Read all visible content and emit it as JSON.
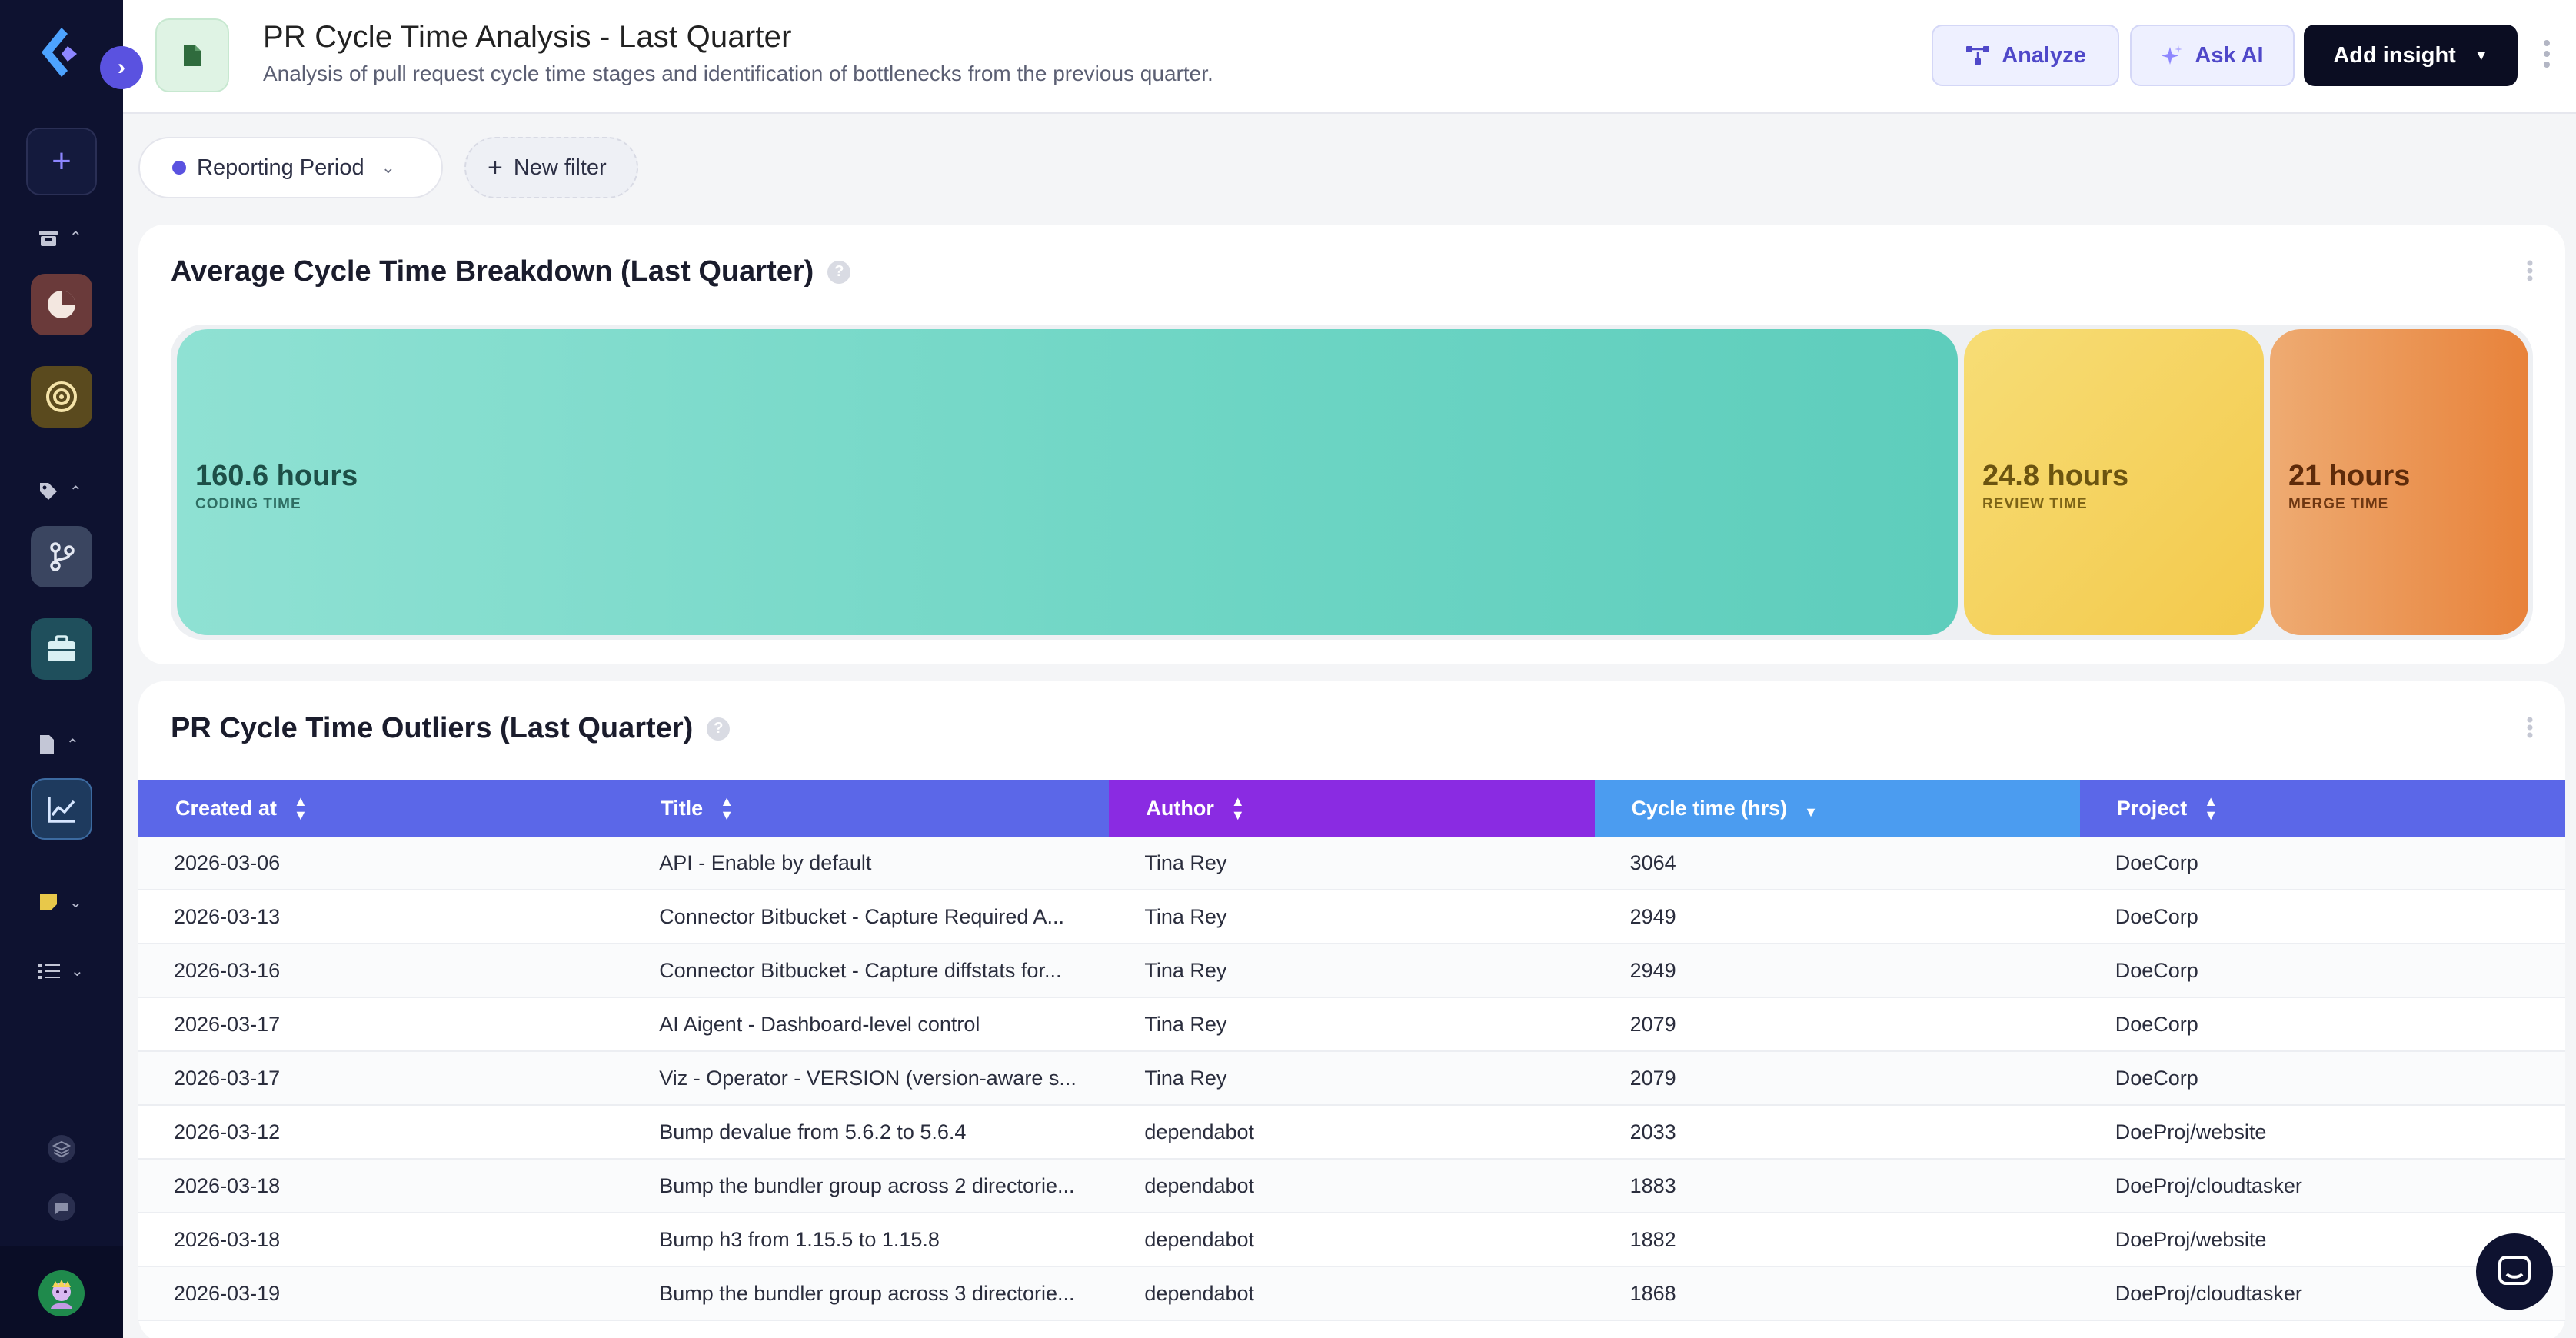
{
  "header": {
    "title": "PR Cycle Time Analysis - Last Quarter",
    "subtitle": "Analysis of pull request cycle time stages and identification of bottlenecks from the previous quarter.",
    "analyze_label": "Analyze",
    "ask_ai_label": "Ask AI",
    "add_insight_label": "Add insight"
  },
  "filters": {
    "period_label": "Reporting Period",
    "new_filter_label": "New filter"
  },
  "breakdown": {
    "title": "Average Cycle Time Breakdown (Last Quarter)",
    "segments": [
      {
        "value": "160.6 hours",
        "caption": "CODING TIME",
        "hours": 160.6,
        "color": "#6dd5c4"
      },
      {
        "value": "24.8 hours",
        "caption": "REVIEW TIME",
        "hours": 24.8,
        "color": "#f3c94b"
      },
      {
        "value": "21 hours",
        "caption": "MERGE TIME",
        "hours": 21,
        "color": "#e8823a"
      }
    ]
  },
  "outliers": {
    "title": "PR Cycle Time Outliers (Last Quarter)",
    "columns": [
      "Created at",
      "Title",
      "Author",
      "Cycle time (hrs)",
      "Project"
    ],
    "header_colors": [
      "#5b67e8",
      "#5b67e8",
      "#8a2be2",
      "#4b9cf0",
      "#5b67e8"
    ],
    "rows": [
      [
        "2026-03-06",
        "API - Enable by default",
        "Tina Rey",
        "3064",
        "DoeCorp"
      ],
      [
        "2026-03-13",
        "Connector Bitbucket - Capture Required A...",
        "Tina Rey",
        "2949",
        "DoeCorp"
      ],
      [
        "2026-03-16",
        "Connector Bitbucket - Capture diffstats for...",
        "Tina Rey",
        "2949",
        "DoeCorp"
      ],
      [
        "2026-03-17",
        "AI Aigent - Dashboard-level control",
        "Tina Rey",
        "2079",
        "DoeCorp"
      ],
      [
        "2026-03-17",
        "Viz - Operator - VERSION (version-aware s...",
        "Tina Rey",
        "2079",
        "DoeCorp"
      ],
      [
        "2026-03-12",
        "Bump devalue from 5.6.2 to 5.6.4",
        "dependabot",
        "2033",
        "DoeProj/website"
      ],
      [
        "2026-03-18",
        "Bump the bundler group across 2 directorie...",
        "dependabot",
        "1883",
        "DoeProj/cloudtasker"
      ],
      [
        "2026-03-18",
        "Bump h3 from 1.15.5 to 1.15.8",
        "dependabot",
        "1882",
        "DoeProj/website"
      ],
      [
        "2026-03-19",
        "Bump the bundler group across 3 directorie...",
        "dependabot",
        "1868",
        "DoeProj/cloudtasker"
      ]
    ]
  },
  "colors": {
    "sidebar_bg": "#0e1230",
    "accent": "#5a52e0",
    "primary_button": "#0b0d22"
  }
}
